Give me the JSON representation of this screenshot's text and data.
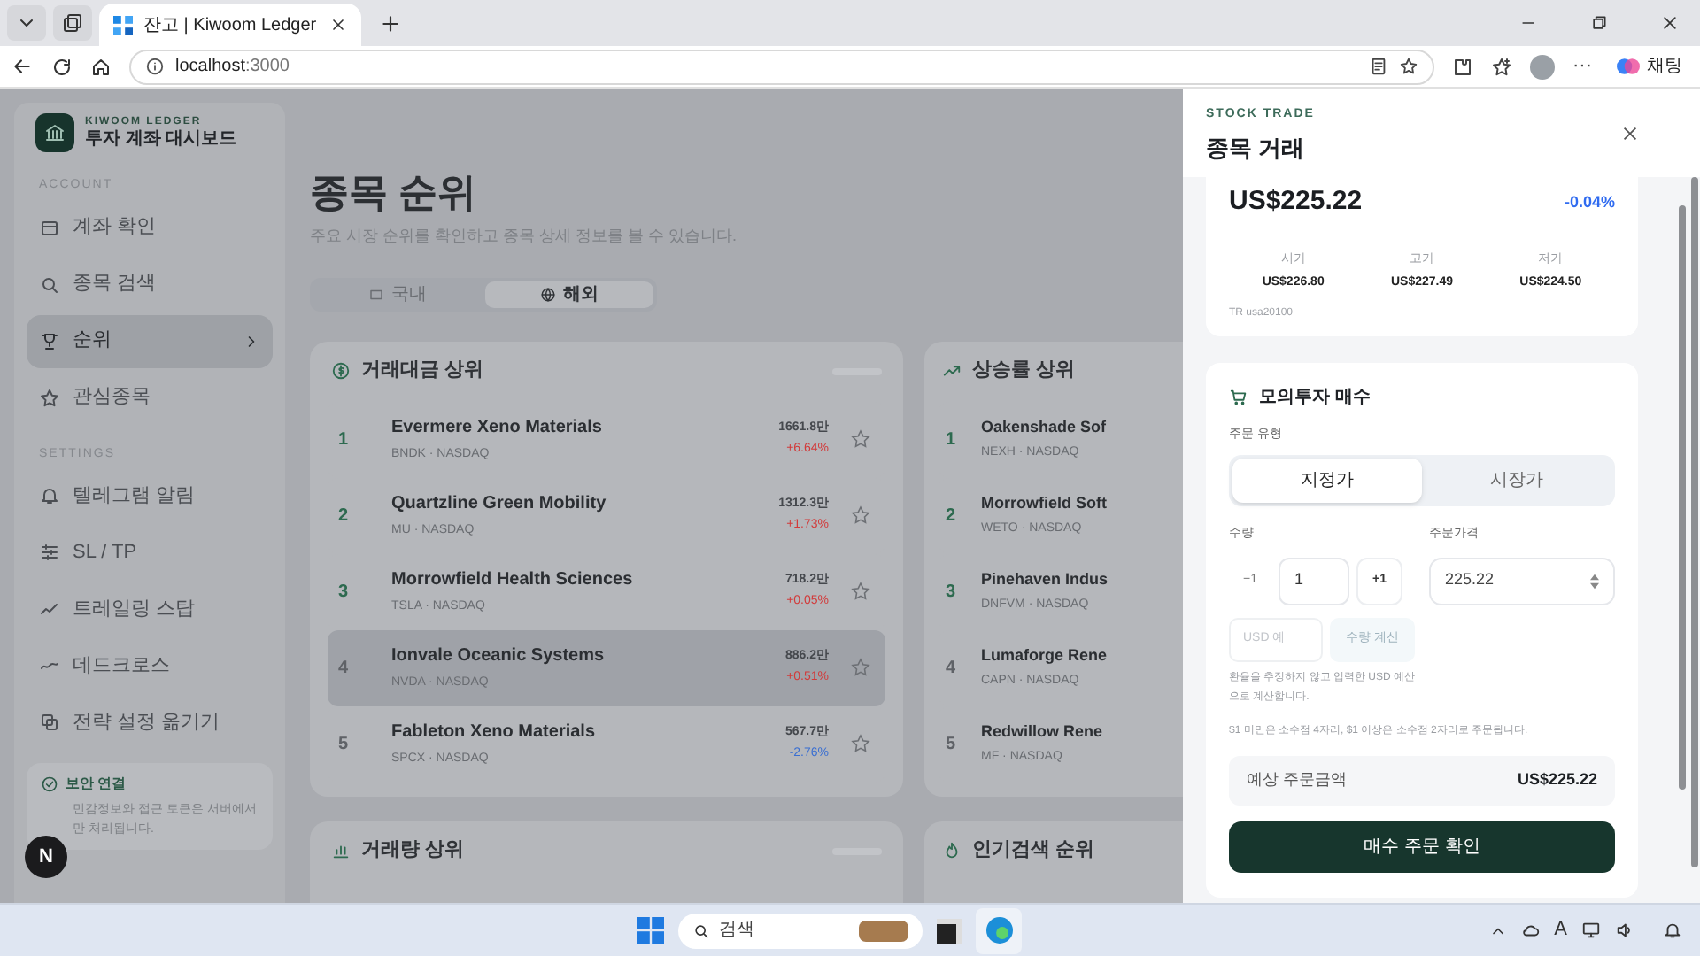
{
  "browser": {
    "tabs": [
      {
        "title": "잔고 | Kiwoom Ledger",
        "selected": true
      }
    ],
    "url_host": "localhost",
    "url_port": ":3000",
    "profile_label": "채팅",
    "more_label": "···"
  },
  "sidebar": {
    "brand_top": "KIWOOM LEDGER",
    "brand": "투자 계좌 대시보드",
    "sections": [
      {
        "title": "ACCOUNT",
        "items": [
          {
            "label": "계좌 확인",
            "selected": false
          },
          {
            "label": "종목 검색",
            "selected": false
          },
          {
            "label": "순위",
            "selected": true
          },
          {
            "label": "관심종목",
            "selected": false
          }
        ]
      },
      {
        "title": "SETTINGS",
        "items": [
          {
            "label": "텔레그램 알림",
            "selected": false
          },
          {
            "label": "SL / TP",
            "selected": false
          },
          {
            "label": "트레일링 스탑",
            "selected": false
          },
          {
            "label": "데드크로스",
            "selected": false
          },
          {
            "label": "전략 설정 옮기기",
            "selected": false
          }
        ]
      }
    ],
    "security": {
      "title": "보안 연결",
      "text": "민감정보와 접근 토큰은 서버에서만 처리됩니다."
    },
    "dev_badge": "N"
  },
  "main": {
    "title": "종목 순위",
    "subtitle": "주요 시장 순위를 확인하고 종목 상세 정보를 볼 수 있습니다.",
    "market_tabs": [
      {
        "label": "국내",
        "selected": false
      },
      {
        "label": "해외",
        "selected": true
      }
    ],
    "panels": [
      {
        "title": "거래대금 상위",
        "rows": [
          {
            "rank": "1",
            "name": "Evermere Xeno Materials",
            "meta": "BNDK · NASDAQ",
            "value": "1661.8만",
            "change": "+6.64%",
            "color": "#d23a3a",
            "highlighted": false
          },
          {
            "rank": "2",
            "name": "Quartzline Green Mobility",
            "meta": "MU · NASDAQ",
            "value": "1312.3만",
            "change": "+1.73%",
            "color": "#d23a3a",
            "highlighted": false
          },
          {
            "rank": "3",
            "name": "Morrowfield Health Sciences",
            "meta": "TSLA · NASDAQ",
            "value": "718.2만",
            "change": "+0.05%",
            "color": "#d23a3a",
            "highlighted": false
          },
          {
            "rank": "4",
            "name": "Ionvale Oceanic Systems",
            "meta": "NVDA · NASDAQ",
            "value": "886.2만",
            "change": "+0.51%",
            "color": "#d23a3a",
            "highlighted": true
          },
          {
            "rank": "5",
            "name": "Fableton Xeno Materials",
            "meta": "SPCX · NASDAQ",
            "value": "567.7만",
            "change": "-2.76%",
            "color": "#3a6fd2",
            "highlighted": false
          }
        ]
      },
      {
        "title": "상승률 상위",
        "rows": [
          {
            "rank": "1",
            "name": "Oakenshade Sof",
            "meta": "NEXH · NASDAQ",
            "highlighted": false
          },
          {
            "rank": "2",
            "name": "Morrowfield Soft",
            "meta": "WETO · NASDAQ",
            "highlighted": false
          },
          {
            "rank": "3",
            "name": "Pinehaven Indus",
            "meta": "DNFVM · NASDAQ",
            "highlighted": false
          },
          {
            "rank": "4",
            "name": "Lumaforge Rene",
            "meta": "CAPN · NASDAQ",
            "highlighted": false
          },
          {
            "rank": "5",
            "name": "Redwillow Rene",
            "meta": "MF · NASDAQ",
            "highlighted": false
          }
        ]
      },
      {
        "title": "거래량 상위"
      },
      {
        "title": "인기검색 순위"
      }
    ]
  },
  "drawer": {
    "eyebrow": "STOCK TRADE",
    "title": "종목 거래",
    "quote": {
      "price": "US$225.22",
      "change": "-0.04%",
      "color": "#2f6bf0",
      "stats": [
        {
          "label": "시가",
          "value": "US$226.80"
        },
        {
          "label": "고가",
          "value": "US$227.49"
        },
        {
          "label": "저가",
          "value": "US$224.50"
        }
      ],
      "tr_code": "TR usa20100"
    },
    "order": {
      "title": "모의투자 매수",
      "order_type_label": "주문 유형",
      "order_types": [
        {
          "label": "지정가",
          "selected": true
        },
        {
          "label": "시장가",
          "selected": false
        }
      ],
      "qty_label": "수량",
      "minus": "−1",
      "qty": "1",
      "plus": "+1",
      "price_label": "주문가격",
      "price": "225.22",
      "budget_placeholder": "USD 예",
      "calc_button": "수량 계산",
      "calc_note": "환율을 추정하지 않고 입력한 USD 예산으로 계산합니다.",
      "rule_note": "$1 미만은 소수점 4자리, $1 이상은 소수점 2자리로 주문됩니다.",
      "estimate_label": "예상 주문금액",
      "estimate_value": "US$225.22",
      "submit": "매수 주문 확인"
    }
  },
  "taskbar": {
    "search_placeholder": "검색",
    "ime_label": "A"
  }
}
